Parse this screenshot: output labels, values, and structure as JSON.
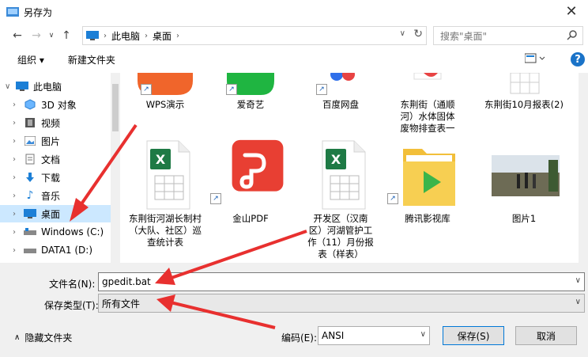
{
  "window": {
    "title": "另存为",
    "close": "✕"
  },
  "address": {
    "crumbs": [
      "此电脑",
      "桌面"
    ],
    "search_placeholder": "搜索\"桌面\""
  },
  "toolbar": {
    "organize": "组织 ▾",
    "new_folder": "新建文件夹",
    "help": "?"
  },
  "sidebar": {
    "items": [
      {
        "label": "此电脑"
      },
      {
        "label": "3D 对象"
      },
      {
        "label": "视频"
      },
      {
        "label": "图片"
      },
      {
        "label": "文档"
      },
      {
        "label": "下载"
      },
      {
        "label": "音乐"
      },
      {
        "label": "桌面"
      },
      {
        "label": "Windows (C:)"
      },
      {
        "label": "DATA1 (D:)"
      }
    ]
  },
  "files": [
    {
      "label": "WPS演示"
    },
    {
      "label": "爱奇艺"
    },
    {
      "label": "百度网盘"
    },
    {
      "label": "东荆街（通顺河）水体固体废物排查表一"
    },
    {
      "label": "东荆街10月报表(2)"
    },
    {
      "label": "东荆街河湖长制村（大队、社区）巡查统计表"
    },
    {
      "label": "金山PDF"
    },
    {
      "label": "开发区（汉南区）河湖管护工作（11）月份报表（样表）"
    },
    {
      "label": "腾讯影视库"
    },
    {
      "label": "图片1"
    }
  ],
  "form": {
    "filename_label": "文件名(N):",
    "filename_value": "gpedit.bat",
    "type_label": "保存类型(T):",
    "type_value": "所有文件",
    "hide_folders": "隐藏文件夹",
    "encoding_label": "编码(E):",
    "encoding_value": "ANSI",
    "save": "保存(S)",
    "cancel": "取消"
  },
  "colors": {
    "accent": "#0078d7",
    "selected_bg": "#cce8ff",
    "arrow": "#e8302f"
  }
}
